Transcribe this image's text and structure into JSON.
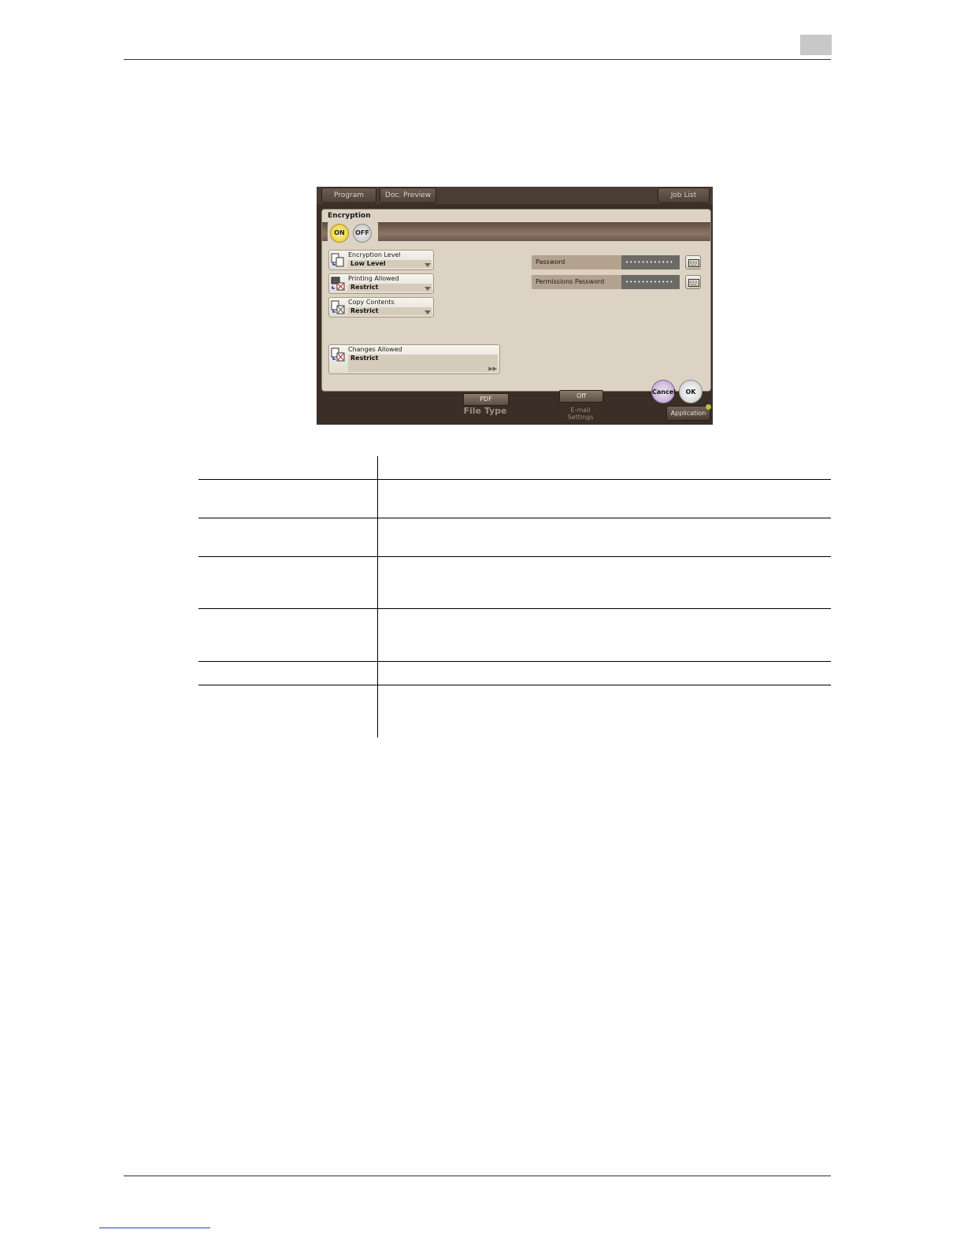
{
  "screen": {
    "topbar": {
      "program": "Program",
      "doc_preview": "Doc. Preview",
      "job_list": "Job List"
    },
    "dialog": {
      "title": "Encryption",
      "toggle_on": "ON",
      "toggle_off": "OFF",
      "settings": [
        {
          "label": "Encryption Level",
          "value": "Low Level"
        },
        {
          "label": "Printing Allowed",
          "value": "Restrict"
        },
        {
          "label": "Copy Contents",
          "value": "Restrict"
        },
        {
          "label": "Changes Allowed",
          "value": "Restrict"
        }
      ],
      "password_label": "Password",
      "password_value": "••••••••••••",
      "permissions_password_label": "Permissions Password",
      "permissions_password_value": "••••••••••••",
      "cancel": "Cancel",
      "ok": "OK"
    },
    "bottom": {
      "file_type_value": "PDF",
      "file_type_caption": "File Type",
      "email_value": "Off",
      "email_caption_1": "E-mail",
      "email_caption_2": "Settings",
      "application": "Application"
    }
  }
}
